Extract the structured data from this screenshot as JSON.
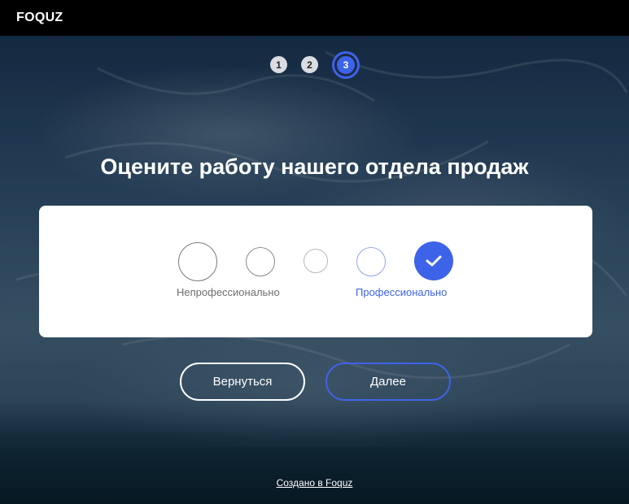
{
  "header": {
    "logo": "FOQUZ"
  },
  "stepper": {
    "steps": [
      "1",
      "2",
      "3"
    ],
    "active_step": 3
  },
  "question": {
    "title": "Оцените работу нашего отдела продаж"
  },
  "rating": {
    "options_count": 5,
    "selected_option": 5,
    "label_min": "Непрофессионально",
    "label_max": "Профессионально"
  },
  "nav": {
    "back_label": "Вернуться",
    "next_label": "Далее"
  },
  "footer": {
    "link": "Создано в Foquz"
  },
  "colors": {
    "accent": "#3d63e8",
    "topbar": "#000000",
    "card": "#ffffff"
  },
  "icons": {
    "selected_mark": "check-icon"
  }
}
